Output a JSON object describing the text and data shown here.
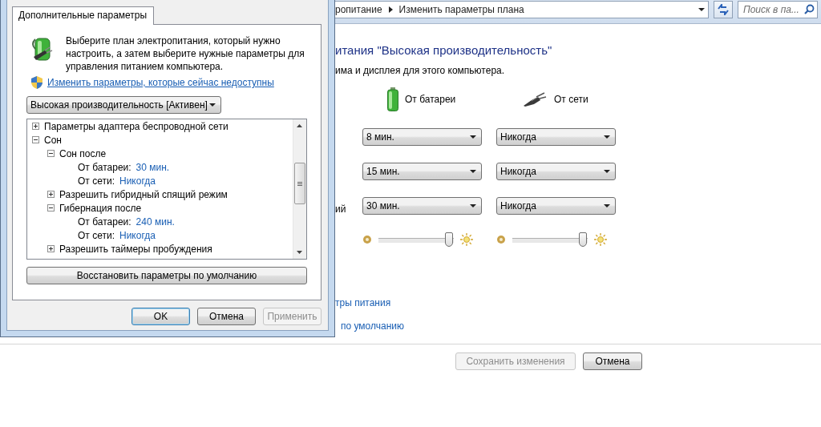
{
  "address_bar": {
    "crumbs": [
      {
        "label": "ропитание"
      },
      {
        "label": "Изменить параметры плана"
      }
    ],
    "search": {
      "placeholder": "Поиск в па..."
    }
  },
  "plan": {
    "title": "итания \"Высокая производительность\"",
    "subtitle": "има и дисплея для этого компьютера.",
    "columns": [
      {
        "kind": "battery",
        "label": "От батареи"
      },
      {
        "kind": "plug",
        "label": "От сети"
      }
    ],
    "rows": [
      {
        "label": "",
        "battery": "8 мин.",
        "plugged": "Никогда"
      },
      {
        "label": "",
        "battery": "15 мин.",
        "plugged": "Никогда"
      },
      {
        "label": "ий",
        "battery": "30 мин.",
        "plugged": "Никогда"
      }
    ],
    "brightness": [
      {
        "level": 0.94
      },
      {
        "level": 0.94
      }
    ],
    "links": [
      "тры питания",
      "по умолчанию"
    ],
    "buttons": [
      {
        "label": "Сохранить изменения",
        "disabled": true
      },
      {
        "label": "Отмена",
        "disabled": false
      }
    ]
  },
  "dialog": {
    "tab": {
      "label": "Дополнительные параметры",
      "selected": true
    },
    "intro": "Выберите план электропитания, который нужно настроить, а затем выберите нужные параметры для управления питанием компьютера.",
    "admin_link": "Изменить параметры, которые сейчас недоступны",
    "plan_select": "Высокая производительность [Активен]",
    "tree": [
      {
        "label": "Параметры адаптера беспроводной сети",
        "expanded": false
      },
      {
        "label": "Сон",
        "expanded": true,
        "children": [
          {
            "label": "Сон после",
            "expanded": true,
            "children": [
              {
                "label": "От батареи:",
                "value": "30 мин."
              },
              {
                "label": "От сети:",
                "value": "Никогда"
              }
            ]
          },
          {
            "label": "Разрешить гибридный спящий режим",
            "expanded": false
          },
          {
            "label": "Гибернация после",
            "expanded": true,
            "children": [
              {
                "label": "От батареи:",
                "value": "240 мин."
              },
              {
                "label": "От сети:",
                "value": "Никогда"
              }
            ]
          },
          {
            "label": "Разрешить таймеры пробуждения",
            "expanded": false
          }
        ]
      }
    ],
    "restore_button": "Восстановить параметры по умолчанию",
    "buttons": [
      {
        "label": "OK",
        "kind": "default",
        "disabled": false
      },
      {
        "label": "Отмена",
        "kind": "normal",
        "disabled": false
      },
      {
        "label": "Применить",
        "kind": "normal",
        "disabled": true
      }
    ]
  }
}
